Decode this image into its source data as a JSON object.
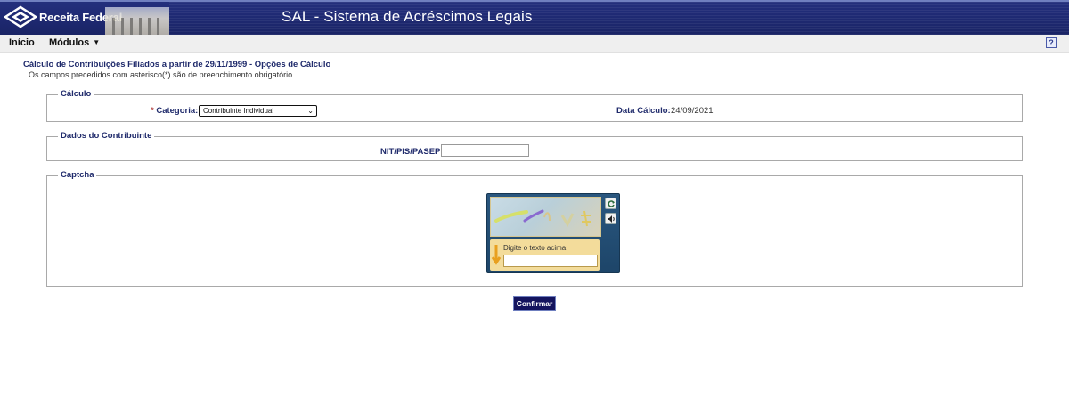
{
  "header": {
    "logo_text": "Receita Federal",
    "app_title": "SAL - Sistema de Acréscimos Legais"
  },
  "menu": {
    "items": [
      {
        "label": "Início"
      },
      {
        "label": "Módulos"
      }
    ]
  },
  "page": {
    "title": "Cálculo de Contribuições Filiados a partir de 29/11/1999 - Opções de Cálculo",
    "subtitle": "Os campos precedidos com asterisco(*) são de preenchimento obrigatório"
  },
  "calculo": {
    "legend": "Cálculo",
    "required_mark": "*",
    "categoria_label": "Categoria:",
    "categoria_selected": "Contribuinte Individual",
    "data_label": "Data Cálculo:",
    "data_value": "24/09/2021"
  },
  "dados": {
    "legend": "Dados do Contribuinte",
    "nit_label": "NIT/PIS/PASEP:",
    "nit_value": ""
  },
  "captcha": {
    "legend": "Captcha",
    "hint": "Digite o texto acima:",
    "value": ""
  },
  "actions": {
    "confirm_label": "Confirmar"
  },
  "colors": {
    "header_bg": "#1f2a74",
    "label_text": "#1f2a6b",
    "required": "#a52020",
    "button_bg": "#14145e"
  }
}
